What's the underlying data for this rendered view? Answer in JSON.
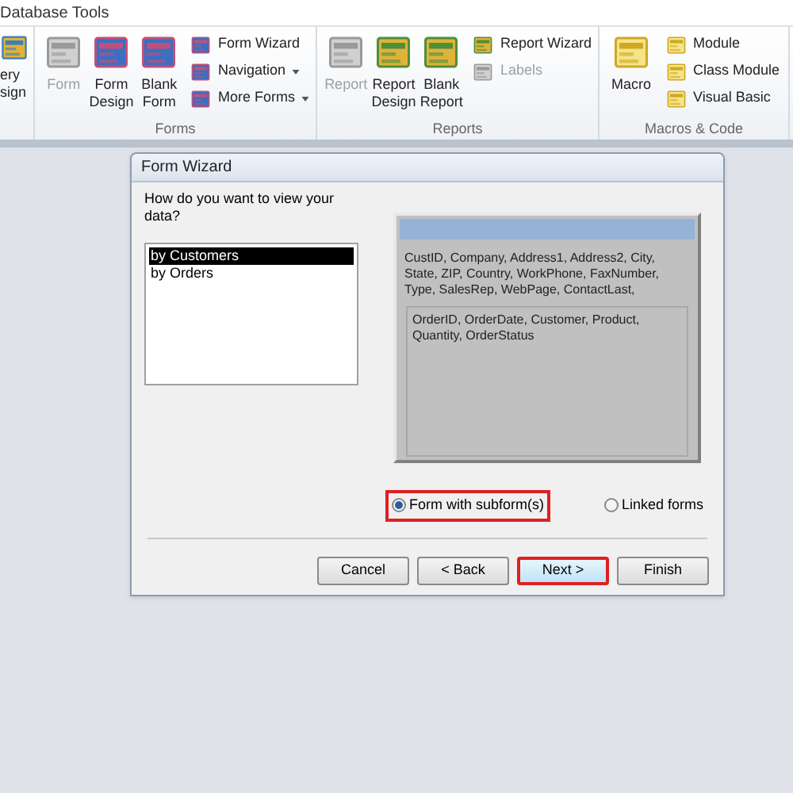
{
  "ribbon": {
    "tab": "Database Tools",
    "groups": [
      {
        "large_buttons": [
          {
            "label": "ery sign",
            "disabled": false
          }
        ]
      },
      {
        "label": "Forms",
        "large_buttons": [
          {
            "label": "Form",
            "disabled": true
          },
          {
            "label": "Form Design",
            "disabled": false
          },
          {
            "label": "Blank Form",
            "disabled": false
          }
        ],
        "small_buttons": [
          {
            "label": "Form Wizard",
            "disabled": false,
            "dropdown": false
          },
          {
            "label": "Navigation",
            "disabled": false,
            "dropdown": true
          },
          {
            "label": "More Forms",
            "disabled": false,
            "dropdown": true
          }
        ]
      },
      {
        "label": "Reports",
        "large_buttons": [
          {
            "label": "Report",
            "disabled": true
          },
          {
            "label": "Report Design",
            "disabled": false
          },
          {
            "label": "Blank Report",
            "disabled": false
          }
        ],
        "small_buttons": [
          {
            "label": "Report Wizard",
            "disabled": false,
            "dropdown": false
          },
          {
            "label": "Labels",
            "disabled": true,
            "dropdown": false
          }
        ]
      },
      {
        "label": "Macros & Code",
        "large_buttons": [
          {
            "label": "Macro",
            "disabled": false
          }
        ],
        "small_buttons": [
          {
            "label": "Module",
            "disabled": false,
            "dropdown": false
          },
          {
            "label": "Class Module",
            "disabled": false,
            "dropdown": false
          },
          {
            "label": "Visual Basic",
            "disabled": false,
            "dropdown": false
          }
        ]
      }
    ]
  },
  "dialog": {
    "title": "Form Wizard",
    "question": "How do you want to view your data?",
    "views": [
      {
        "label": "by Customers",
        "selected": true
      },
      {
        "label": "by Orders",
        "selected": false
      }
    ],
    "preview": {
      "main_fields": "CustID, Company, Address1, Address2, City, State, ZIP, Country, WorkPhone, FaxNumber, Type, SalesRep, WebPage, ContactLast,",
      "sub_fields": "OrderID, OrderDate, Customer, Product, Quantity, OrderStatus"
    },
    "options": [
      {
        "label": "Form with subform(s)",
        "selected": true,
        "highlighted": true
      },
      {
        "label": "Linked forms",
        "selected": false,
        "highlighted": false
      }
    ],
    "buttons": [
      {
        "label": "Cancel",
        "highlighted": false
      },
      {
        "label": "< Back",
        "highlighted": false
      },
      {
        "label": "Next >",
        "highlighted": true
      },
      {
        "label": "Finish",
        "highlighted": false
      }
    ]
  }
}
